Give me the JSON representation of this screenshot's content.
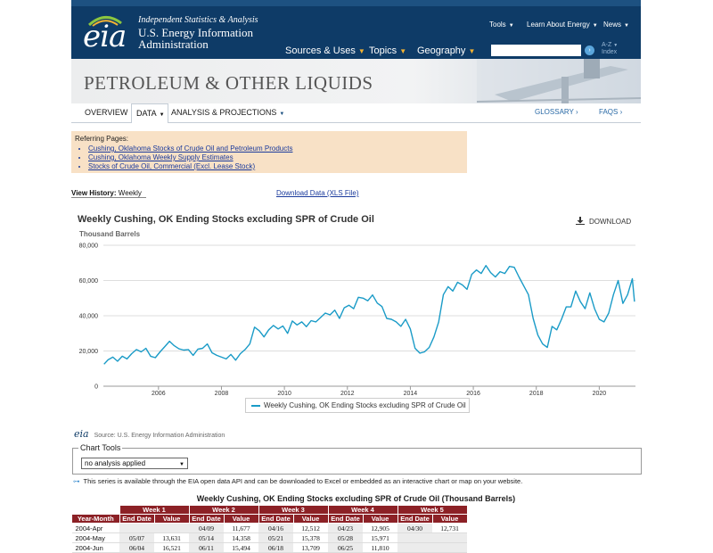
{
  "header": {
    "logo_text": "eia",
    "tagline": "Independent Statistics & Analysis",
    "org_line1": "U.S. Energy Information",
    "org_line2": "Administration",
    "main_nav": [
      "Sources & Uses",
      "Topics",
      "Geography"
    ],
    "top_nav": [
      "Tools",
      "Learn About Energy",
      "News"
    ],
    "search_placeholder": "",
    "az_line1": "A-Z",
    "az_line2": "Index"
  },
  "banner": {
    "title": "PETROLEUM & OTHER LIQUIDS"
  },
  "subnav": {
    "overview": "OVERVIEW",
    "data": "DATA",
    "analysis": "ANALYSIS & PROJECTIONS",
    "glossary": "GLOSSARY ›",
    "faqs": "FAQS ›"
  },
  "referring": {
    "heading": "Referring Pages:",
    "links": [
      "Cushing, Oklahoma Stocks of Crude Oil and Petroleum Products",
      "Cushing, Oklahoma Weekly Supply Estimates",
      "Stocks of Crude Oil, Commercial (Excl. Lease Stock)"
    ]
  },
  "view_history_label": "View History:",
  "view_history_value": "Weekly",
  "download_data": "Download Data (XLS File)",
  "chart_header": {
    "title": "Weekly Cushing, OK Ending Stocks excluding SPR of Crude Oil",
    "units": "Thousand Barrels",
    "download": "DOWNLOAD"
  },
  "chart_data": {
    "type": "line",
    "title": "Weekly Cushing, OK Ending Stocks excluding SPR of Crude Oil",
    "ylabel": "Thousand Barrels",
    "xlabel": "",
    "ylim": [
      0,
      80000
    ],
    "xlim": [
      2004.25,
      2021.15
    ],
    "y_ticks": [
      "0",
      "20,000",
      "40,000",
      "60,000",
      "80,000"
    ],
    "x_ticks": [
      "2006",
      "2008",
      "2010",
      "2012",
      "2014",
      "2016",
      "2018",
      "2020"
    ],
    "grid": true,
    "legend_position": "bottom",
    "series": [
      {
        "name": "Weekly Cushing, OK Ending Stocks excluding SPR of Crude Oil",
        "color": "#1a9bc7",
        "x": [
          2004.27,
          2004.4,
          2004.55,
          2004.7,
          2004.85,
          2005.0,
          2005.15,
          2005.3,
          2005.45,
          2005.6,
          2005.75,
          2005.9,
          2006.05,
          2006.2,
          2006.35,
          2006.5,
          2006.65,
          2006.8,
          2006.95,
          2007.1,
          2007.25,
          2007.4,
          2007.55,
          2007.7,
          2007.85,
          2008.0,
          2008.15,
          2008.3,
          2008.45,
          2008.6,
          2008.75,
          2008.9,
          2009.05,
          2009.2,
          2009.35,
          2009.5,
          2009.65,
          2009.8,
          2009.95,
          2010.1,
          2010.25,
          2010.4,
          2010.55,
          2010.7,
          2010.85,
          2011.0,
          2011.15,
          2011.3,
          2011.45,
          2011.6,
          2011.75,
          2011.9,
          2012.05,
          2012.2,
          2012.35,
          2012.5,
          2012.65,
          2012.8,
          2012.95,
          2013.1,
          2013.25,
          2013.4,
          2013.55,
          2013.7,
          2013.85,
          2014.0,
          2014.15,
          2014.3,
          2014.45,
          2014.6,
          2014.75,
          2014.9,
          2015.05,
          2015.2,
          2015.35,
          2015.5,
          2015.65,
          2015.8,
          2015.95,
          2016.1,
          2016.25,
          2016.4,
          2016.55,
          2016.7,
          2016.85,
          2017.0,
          2017.15,
          2017.3,
          2017.45,
          2017.6,
          2017.75,
          2017.9,
          2018.05,
          2018.2,
          2018.35,
          2018.5,
          2018.65,
          2018.8,
          2018.95,
          2019.1,
          2019.25,
          2019.4,
          2019.55,
          2019.7,
          2019.85,
          2020.0,
          2020.15,
          2020.3,
          2020.45,
          2020.6,
          2020.75,
          2020.9,
          2021.05,
          2021.12
        ],
        "values": [
          12500,
          15000,
          16500,
          14200,
          17000,
          15500,
          18500,
          20800,
          19500,
          21500,
          17000,
          16200,
          19500,
          22500,
          25500,
          23000,
          21200,
          20500,
          20800,
          17500,
          21000,
          21500,
          24000,
          19000,
          17500,
          16500,
          15500,
          18000,
          14800,
          18500,
          20800,
          24000,
          33500,
          31500,
          28000,
          32000,
          34500,
          32500,
          34200,
          30000,
          37000,
          34800,
          36500,
          33800,
          37200,
          36500,
          39000,
          41500,
          40500,
          43200,
          38500,
          44500,
          46000,
          44000,
          50500,
          50000,
          48500,
          51800,
          47200,
          45200,
          38500,
          38000,
          36500,
          34000,
          38000,
          32500,
          21500,
          18800,
          19500,
          22000,
          28000,
          36500,
          52000,
          56500,
          54000,
          59000,
          57500,
          55000,
          63500,
          66000,
          64000,
          68500,
          64500,
          62000,
          65000,
          64000,
          68000,
          67500,
          62000,
          57000,
          52000,
          38500,
          29000,
          24000,
          22000,
          34000,
          32000,
          38000,
          45000,
          45000,
          54000,
          48000,
          44000,
          53000,
          44000,
          38000,
          36500,
          41500,
          52000,
          60000,
          47000,
          52000,
          61000,
          48000
        ]
      }
    ]
  },
  "chart_legend": "Weekly Cushing, OK Ending Stocks excluding SPR of Crude Oil",
  "source": {
    "logo": "eia",
    "text": "Source: U.S. Energy Information Administration"
  },
  "chart_tools": {
    "legend": "Chart Tools",
    "selected": "no analysis applied"
  },
  "api_note": "This series is available through the EIA open data API and can be downloaded to Excel or embedded as an interactive chart or map on your website.",
  "table": {
    "title": "Weekly Cushing, OK Ending Stocks excluding SPR of Crude Oil (Thousand Barrels)",
    "week_headers": [
      "Week 1",
      "Week 2",
      "Week 3",
      "Week 4",
      "Week 5"
    ],
    "col_ym": "Year-Month",
    "col_end_date": "End Date",
    "col_value": "Value",
    "rows": [
      {
        "ym": "2004-Apr",
        "cells": [
          [
            "",
            ""
          ],
          [
            "04/09",
            "11,677"
          ],
          [
            "04/16",
            "12,512"
          ],
          [
            "04/23",
            "12,905"
          ],
          [
            "04/30",
            "12,731"
          ]
        ]
      },
      {
        "ym": "2004-May",
        "cells": [
          [
            "05/07",
            "13,631"
          ],
          [
            "05/14",
            "14,358"
          ],
          [
            "05/21",
            "15,378"
          ],
          [
            "05/28",
            "15,971"
          ],
          [
            "",
            ""
          ]
        ]
      },
      {
        "ym": "2004-Jun",
        "cells": [
          [
            "06/04",
            "16,521"
          ],
          [
            "06/11",
            "15,494"
          ],
          [
            "06/18",
            "13,709"
          ],
          [
            "06/25",
            "11,810"
          ],
          [
            "",
            ""
          ]
        ]
      }
    ]
  }
}
